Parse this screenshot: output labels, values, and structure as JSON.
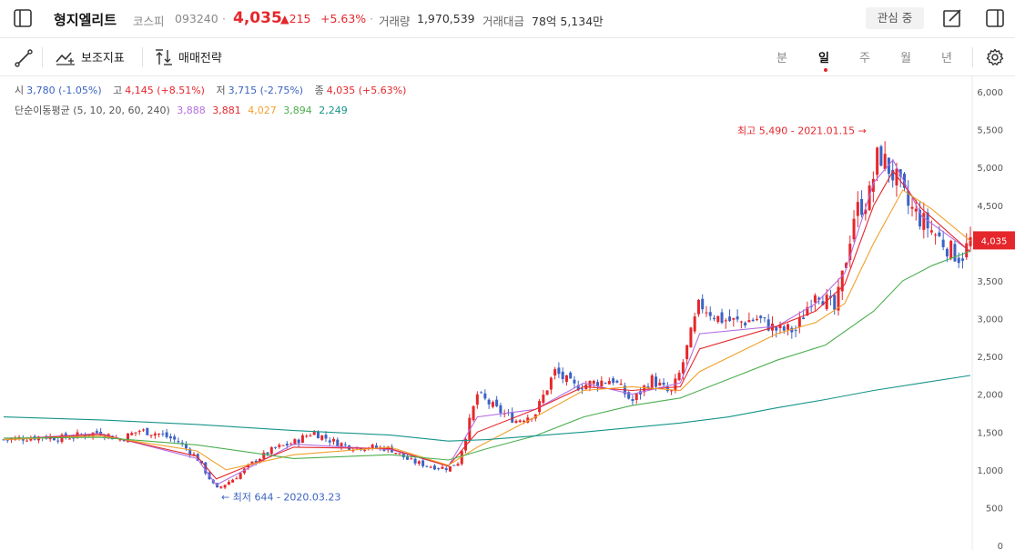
{
  "header": {
    "stock_name": "형지엘리트",
    "market": "코스피",
    "code": "093240",
    "separator": "·",
    "price": "4,035",
    "change": "▲215",
    "change_pct": "+5.63%",
    "volume_label": "거래량",
    "volume_value": "1,970,539",
    "amount_label": "거래대금",
    "amount_value": "78억 5,134만",
    "favorite_label": "관심 중"
  },
  "toolbar": {
    "indicator_label": "보조지표",
    "strategy_label": "매매전략",
    "periods": [
      "분",
      "일",
      "주",
      "월",
      "년"
    ],
    "active_period": "일"
  },
  "ohlc": {
    "open_label": "시",
    "open_value": "3,780 (-1.05%)",
    "high_label": "고",
    "high_value": "4,145 (+8.51%)",
    "low_label": "저",
    "low_value": "3,715 (-2.75%)",
    "close_label": "종",
    "close_value": "4,035 (+5.63%)"
  },
  "ma": {
    "label": "단순이동평균 (5, 10, 20, 60, 240)",
    "values": [
      "3,888",
      "3,881",
      "4,027",
      "3,894",
      "2,249"
    ],
    "colors": [
      "#b46ee0",
      "#e5272c",
      "#f0a12b",
      "#4caf50",
      "#16948a"
    ]
  },
  "colors": {
    "up": "#e5272c",
    "down": "#3b63c4",
    "accent": "#e5272c"
  },
  "chart_data": {
    "type": "line",
    "annotations": {
      "high": "최고 5,490 - 2021.01.15 →",
      "low": "← 최저 644 - 2020.03.23"
    },
    "current_price_tag": "4,035",
    "y_ticks": [
      "6,000",
      "5,500",
      "5,000",
      "4,500",
      "4,000",
      "3,500",
      "3,000",
      "2,500",
      "2,000",
      "1,500",
      "1,000",
      "500",
      "0"
    ],
    "ylim": [
      0,
      6000
    ],
    "grid": false,
    "close_series": [
      [
        0,
        1400
      ],
      [
        0.02,
        1420
      ],
      [
        0.04,
        1440
      ],
      [
        0.06,
        1420
      ],
      [
        0.08,
        1460
      ],
      [
        0.1,
        1500
      ],
      [
        0.12,
        1400
      ],
      [
        0.14,
        1520
      ],
      [
        0.16,
        1480
      ],
      [
        0.18,
        1380
      ],
      [
        0.2,
        1160
      ],
      [
        0.22,
        740
      ],
      [
        0.24,
        900
      ],
      [
        0.26,
        1120
      ],
      [
        0.28,
        1280
      ],
      [
        0.3,
        1360
      ],
      [
        0.32,
        1500
      ],
      [
        0.34,
        1380
      ],
      [
        0.36,
        1300
      ],
      [
        0.38,
        1300
      ],
      [
        0.4,
        1280
      ],
      [
        0.42,
        1120
      ],
      [
        0.44,
        1050
      ],
      [
        0.46,
        1020
      ],
      [
        0.47,
        1100
      ],
      [
        0.49,
        2000
      ],
      [
        0.51,
        1800
      ],
      [
        0.53,
        1650
      ],
      [
        0.55,
        1750
      ],
      [
        0.57,
        2300
      ],
      [
        0.59,
        2100
      ],
      [
        0.61,
        2150
      ],
      [
        0.63,
        2200
      ],
      [
        0.65,
        1900
      ],
      [
        0.67,
        2200
      ],
      [
        0.69,
        2000
      ],
      [
        0.7,
        2300
      ],
      [
        0.72,
        3200
      ],
      [
        0.74,
        3000
      ],
      [
        0.76,
        2950
      ],
      [
        0.78,
        3000
      ],
      [
        0.8,
        2850
      ],
      [
        0.82,
        2850
      ],
      [
        0.84,
        3400
      ],
      [
        0.86,
        3100
      ],
      [
        0.87,
        3700
      ],
      [
        0.88,
        4400
      ],
      [
        0.895,
        4600
      ],
      [
        0.905,
        5200
      ],
      [
        0.915,
        5000
      ],
      [
        0.925,
        4800
      ],
      [
        0.935,
        4500
      ],
      [
        0.95,
        4300
      ],
      [
        0.965,
        4100
      ],
      [
        0.98,
        3900
      ],
      [
        0.99,
        3800
      ],
      [
        1,
        4035
      ]
    ],
    "ma_series": {
      "ma5": [
        [
          0,
          1400
        ],
        [
          0.1,
          1480
        ],
        [
          0.2,
          1150
        ],
        [
          0.22,
          800
        ],
        [
          0.3,
          1340
        ],
        [
          0.4,
          1270
        ],
        [
          0.46,
          1050
        ],
        [
          0.49,
          1700
        ],
        [
          0.55,
          1800
        ],
        [
          0.6,
          2150
        ],
        [
          0.65,
          2000
        ],
        [
          0.7,
          2150
        ],
        [
          0.72,
          2800
        ],
        [
          0.8,
          2900
        ],
        [
          0.84,
          3200
        ],
        [
          0.87,
          3600
        ],
        [
          0.9,
          4800
        ],
        [
          0.92,
          5100
        ],
        [
          0.95,
          4350
        ],
        [
          1,
          3888
        ]
      ],
      "ma10": [
        [
          0,
          1400
        ],
        [
          0.1,
          1470
        ],
        [
          0.2,
          1180
        ],
        [
          0.22,
          880
        ],
        [
          0.3,
          1300
        ],
        [
          0.4,
          1280
        ],
        [
          0.46,
          1050
        ],
        [
          0.49,
          1500
        ],
        [
          0.55,
          1800
        ],
        [
          0.6,
          2100
        ],
        [
          0.65,
          2050
        ],
        [
          0.7,
          2100
        ],
        [
          0.72,
          2600
        ],
        [
          0.8,
          2900
        ],
        [
          0.84,
          3100
        ],
        [
          0.87,
          3450
        ],
        [
          0.9,
          4500
        ],
        [
          0.92,
          4950
        ],
        [
          0.95,
          4450
        ],
        [
          1,
          3881
        ]
      ],
      "ma20": [
        [
          0,
          1400
        ],
        [
          0.1,
          1450
        ],
        [
          0.2,
          1250
        ],
        [
          0.23,
          1000
        ],
        [
          0.3,
          1200
        ],
        [
          0.4,
          1300
        ],
        [
          0.46,
          1060
        ],
        [
          0.49,
          1300
        ],
        [
          0.55,
          1700
        ],
        [
          0.6,
          2050
        ],
        [
          0.65,
          2100
        ],
        [
          0.7,
          2050
        ],
        [
          0.72,
          2300
        ],
        [
          0.8,
          2800
        ],
        [
          0.84,
          2950
        ],
        [
          0.87,
          3200
        ],
        [
          0.9,
          4000
        ],
        [
          0.93,
          4700
        ],
        [
          0.96,
          4450
        ],
        [
          1,
          4027
        ]
      ],
      "ma60": [
        [
          0,
          1420
        ],
        [
          0.1,
          1430
        ],
        [
          0.2,
          1330
        ],
        [
          0.3,
          1150
        ],
        [
          0.4,
          1200
        ],
        [
          0.46,
          1130
        ],
        [
          0.5,
          1280
        ],
        [
          0.55,
          1450
        ],
        [
          0.6,
          1700
        ],
        [
          0.65,
          1850
        ],
        [
          0.7,
          1950
        ],
        [
          0.75,
          2200
        ],
        [
          0.8,
          2450
        ],
        [
          0.85,
          2650
        ],
        [
          0.9,
          3100
        ],
        [
          0.93,
          3500
        ],
        [
          0.96,
          3700
        ],
        [
          1,
          3894
        ]
      ],
      "ma240": [
        [
          0,
          1700
        ],
        [
          0.1,
          1660
        ],
        [
          0.2,
          1600
        ],
        [
          0.3,
          1520
        ],
        [
          0.4,
          1460
        ],
        [
          0.46,
          1380
        ],
        [
          0.5,
          1400
        ],
        [
          0.55,
          1450
        ],
        [
          0.6,
          1500
        ],
        [
          0.65,
          1560
        ],
        [
          0.7,
          1620
        ],
        [
          0.75,
          1700
        ],
        [
          0.8,
          1820
        ],
        [
          0.85,
          1930
        ],
        [
          0.9,
          2050
        ],
        [
          0.95,
          2150
        ],
        [
          1,
          2249
        ]
      ]
    }
  }
}
